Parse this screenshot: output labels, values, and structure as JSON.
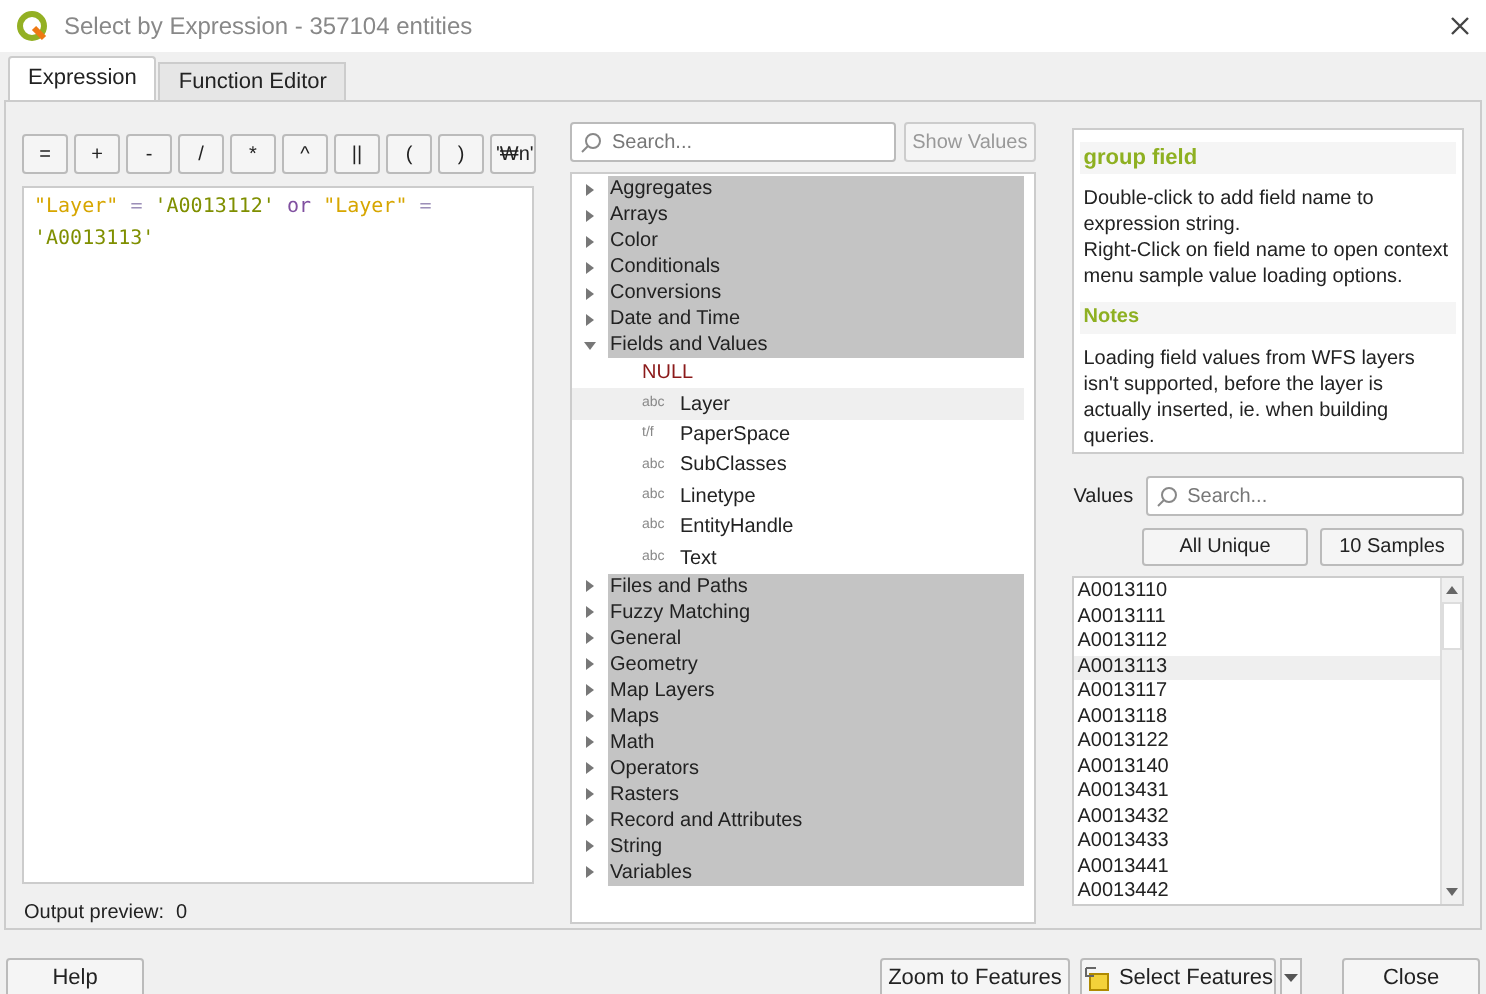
{
  "window": {
    "title": "Select by Expression - 357104 entities"
  },
  "tabs": [
    {
      "label": "Expression",
      "selected": true
    },
    {
      "label": "Function Editor",
      "selected": false
    }
  ],
  "operators": [
    "=",
    "+",
    "-",
    "/",
    "*",
    "^",
    "||",
    "(",
    ")",
    "'₩n'"
  ],
  "expression": [
    {
      "kind": "field",
      "text": "\"Layer\""
    },
    {
      "kind": "operator",
      "text": "="
    },
    {
      "kind": "string",
      "text": "'A0013112'"
    },
    {
      "kind": "keyword",
      "text": "or"
    },
    {
      "kind": "field",
      "text": "\"Layer\""
    },
    {
      "kind": "operator",
      "text": "="
    },
    {
      "kind": "string",
      "text": "'A0013113'"
    }
  ],
  "output_preview": {
    "label": "Output preview:",
    "value": "0"
  },
  "function_search": {
    "placeholder": "Search..."
  },
  "show_values_button": "Show Values",
  "function_tree": [
    {
      "label": "Aggregates",
      "expanded": false
    },
    {
      "label": "Arrays",
      "expanded": false
    },
    {
      "label": "Color",
      "expanded": false
    },
    {
      "label": "Conditionals",
      "expanded": false
    },
    {
      "label": "Conversions",
      "expanded": false
    },
    {
      "label": "Date and Time",
      "expanded": false
    },
    {
      "label": "Fields and Values",
      "expanded": true,
      "children": [
        {
          "label": "NULL",
          "kind": "null",
          "selected": false
        },
        {
          "label": "Layer",
          "kind": "field",
          "type": "abc",
          "selected": true
        },
        {
          "label": "PaperSpace",
          "kind": "field",
          "type": "t/f",
          "selected": false
        },
        {
          "label": "SubClasses",
          "kind": "field",
          "type": "abc",
          "selected": false
        },
        {
          "label": "Linetype",
          "kind": "field",
          "type": "abc",
          "selected": false
        },
        {
          "label": "EntityHandle",
          "kind": "field",
          "type": "abc",
          "selected": false
        },
        {
          "label": "Text",
          "kind": "field",
          "type": "abc",
          "selected": false
        }
      ]
    },
    {
      "label": "Files and Paths",
      "expanded": false
    },
    {
      "label": "Fuzzy Matching",
      "expanded": false
    },
    {
      "label": "General",
      "expanded": false
    },
    {
      "label": "Geometry",
      "expanded": false
    },
    {
      "label": "Map Layers",
      "expanded": false
    },
    {
      "label": "Maps",
      "expanded": false
    },
    {
      "label": "Math",
      "expanded": false
    },
    {
      "label": "Operators",
      "expanded": false
    },
    {
      "label": "Rasters",
      "expanded": false
    },
    {
      "label": "Record and Attributes",
      "expanded": false
    },
    {
      "label": "String",
      "expanded": false
    },
    {
      "label": "Variables",
      "expanded": false
    }
  ],
  "help": {
    "title": "group field",
    "body": [
      "Double-click to add field name to expression string.",
      "Right-Click on field name to open context menu sample value loading options."
    ],
    "notes_title": "Notes",
    "notes": "Loading field values from WFS layers isn't supported, before the layer is actually inserted, ie. when building queries."
  },
  "values": {
    "label": "Values",
    "search_placeholder": "Search...",
    "buttons": [
      "All Unique",
      "10 Samples"
    ],
    "items": [
      {
        "text": "A0013110",
        "selected": false
      },
      {
        "text": "A0013111",
        "selected": false
      },
      {
        "text": "A0013112",
        "selected": false
      },
      {
        "text": "A0013113",
        "selected": true
      },
      {
        "text": "A0013117",
        "selected": false
      },
      {
        "text": "A0013118",
        "selected": false
      },
      {
        "text": "A0013122",
        "selected": false
      },
      {
        "text": "A0013140",
        "selected": false
      },
      {
        "text": "A0013431",
        "selected": false
      },
      {
        "text": "A0013432",
        "selected": false
      },
      {
        "text": "A0013433",
        "selected": false
      },
      {
        "text": "A0013441",
        "selected": false
      },
      {
        "text": "A0013442",
        "selected": false
      }
    ]
  },
  "buttons": {
    "help": "Help",
    "zoom": "Zoom to Features",
    "select": "Select Features",
    "close": "Close"
  }
}
